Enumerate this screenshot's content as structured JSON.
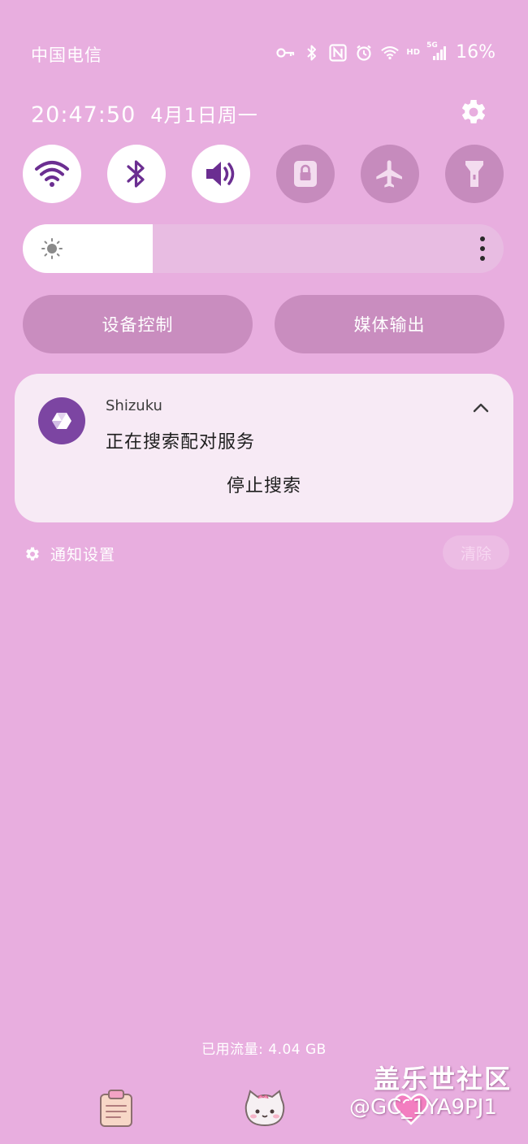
{
  "status_bar": {
    "carrier": "中国电信",
    "hd_label": "HD",
    "network_label": "5G",
    "battery": "16%",
    "icons": [
      "key-icon",
      "bluetooth-icon",
      "nfc-icon",
      "alarm-icon",
      "wifi-icon",
      "signal-icon"
    ]
  },
  "header": {
    "time": "20:47:50",
    "date": "4月1日周一"
  },
  "quick_toggles": [
    {
      "name": "wifi",
      "icon": "wifi-icon",
      "active": true
    },
    {
      "name": "bluetooth",
      "icon": "bluetooth-icon",
      "active": true
    },
    {
      "name": "sound",
      "icon": "speaker-icon",
      "active": true
    },
    {
      "name": "rotation-lock",
      "icon": "lock-icon",
      "active": false
    },
    {
      "name": "airplane-mode",
      "icon": "airplane-icon",
      "active": false
    },
    {
      "name": "flashlight",
      "icon": "flashlight-icon",
      "active": false
    }
  ],
  "brightness": {
    "level": 0.27
  },
  "buttons": {
    "device_control": "设备控制",
    "media_output": "媒体输出"
  },
  "notification": {
    "app_name": "Shizuku",
    "title": "正在搜索配对服务",
    "action": "停止搜索"
  },
  "notification_footer": {
    "settings_label": "通知设置",
    "clear_label": "清除"
  },
  "footer": {
    "data_used": "已用流量: 4.04 GB"
  },
  "watermark": {
    "title": "盖乐世社区",
    "user_id": "@GC_1YA9PJ1"
  },
  "colors": {
    "background": "#e8aedf",
    "toggle_off": "#c68bbd",
    "accent": "#6b2e91",
    "card": "#f7eaf5"
  }
}
